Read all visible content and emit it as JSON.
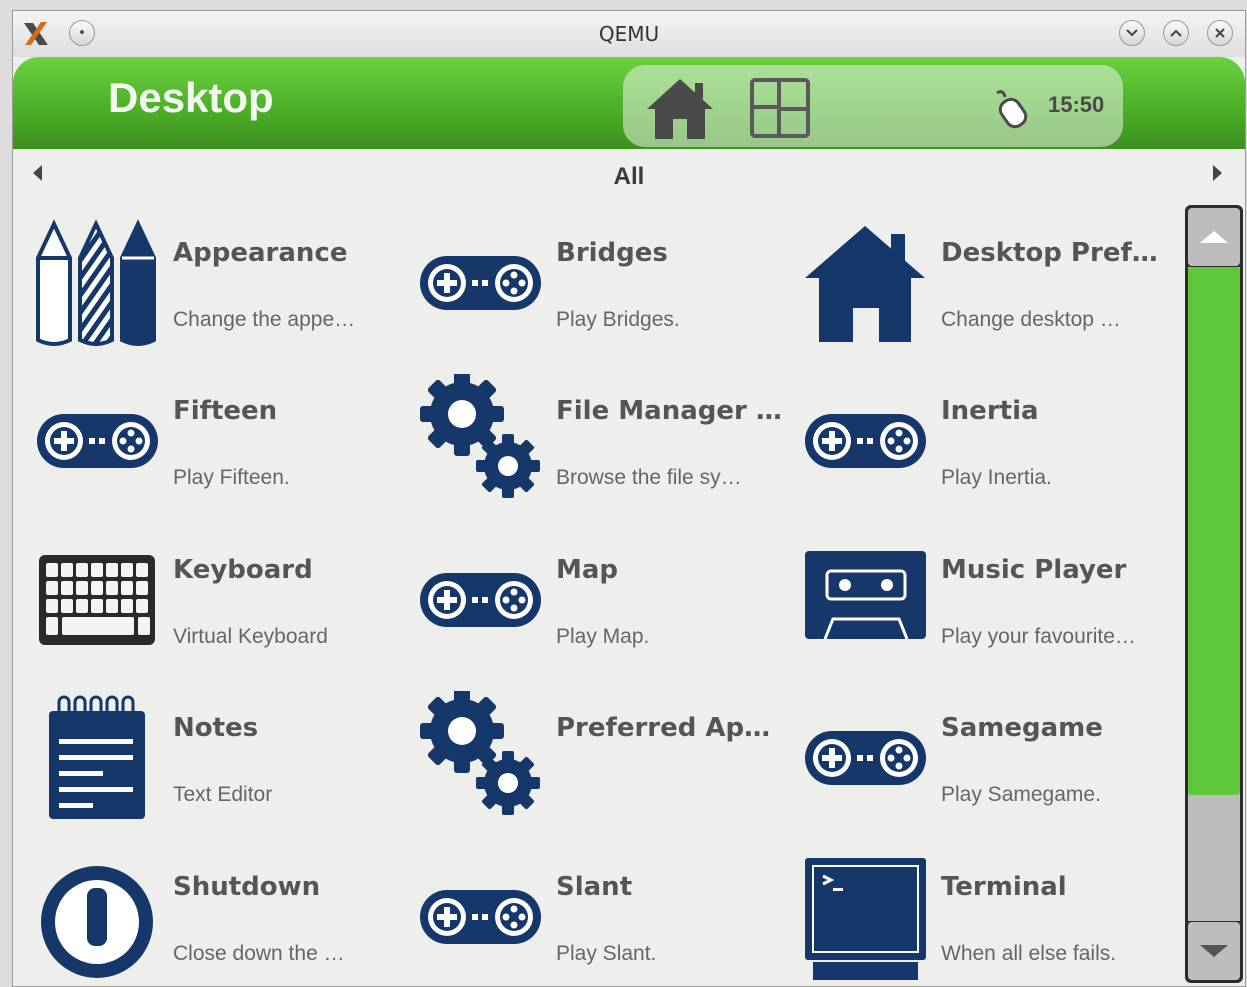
{
  "window": {
    "title": "QEMU"
  },
  "header": {
    "title": "Desktop",
    "clock": "15:50"
  },
  "category": {
    "label": "All"
  },
  "colors": {
    "header_green": "#4cb128",
    "icon_blue": "#15376a",
    "scroll_thumb": "#5ec73a"
  },
  "apps": [
    {
      "name": "Appearance",
      "description": "Change the appe…",
      "icon": "pencils-icon"
    },
    {
      "name": "Bridges",
      "description": "Play Bridges.",
      "icon": "gamepad-icon"
    },
    {
      "name": "Desktop Pref…",
      "description": "Change desktop …",
      "icon": "house-icon"
    },
    {
      "name": "Fifteen",
      "description": "Play Fifteen.",
      "icon": "gamepad-icon"
    },
    {
      "name": "File Manager …",
      "description": "Browse the file sy…",
      "icon": "gears-icon"
    },
    {
      "name": "Inertia",
      "description": "Play Inertia.",
      "icon": "gamepad-icon"
    },
    {
      "name": "Keyboard",
      "description": "Virtual Keyboard",
      "icon": "keyboard-icon"
    },
    {
      "name": "Map",
      "description": "Play Map.",
      "icon": "gamepad-icon"
    },
    {
      "name": "Music Player",
      "description": "Play your favourite…",
      "icon": "cassette-icon"
    },
    {
      "name": "Notes",
      "description": "Text Editor",
      "icon": "notepad-icon"
    },
    {
      "name": "Preferred Ap…",
      "description": "",
      "icon": "gears-icon"
    },
    {
      "name": "Samegame",
      "description": "Play Samegame.",
      "icon": "gamepad-icon"
    },
    {
      "name": "Shutdown",
      "description": "Close down the …",
      "icon": "power-icon"
    },
    {
      "name": "Slant",
      "description": "Play Slant.",
      "icon": "gamepad-icon"
    },
    {
      "name": "Terminal",
      "description": "When all else fails.",
      "icon": "terminal-icon"
    }
  ]
}
